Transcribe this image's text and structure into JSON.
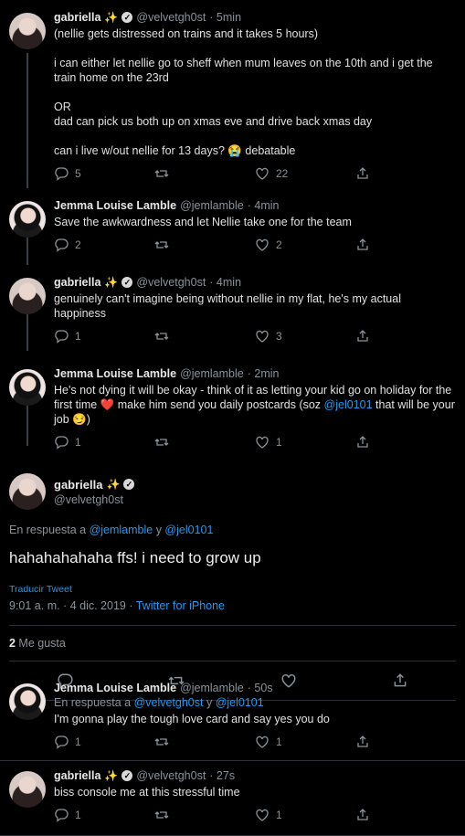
{
  "tweets": [
    {
      "name": "gabriella",
      "emoji": "✨",
      "handle": "@velvetgh0st",
      "time": "· 5min",
      "text": "(nellie gets distressed on trains and it takes 5 hours)\n\ni can either let nellie go to sheff when mum leaves on the 10th and i get the train home on the 23rd\n\nOR\ndad can pick us both up on xmas eve and drive back xmas day\n\ncan i live w/out nellie for 13 days? 😭 debatable",
      "replies": "5",
      "likes": "22"
    },
    {
      "name": "Jemma Louise Lamble",
      "handle": "@jemlamble",
      "time": "· 4min",
      "text": "Save the awkwardness and let Nellie take one for the team",
      "replies": "2",
      "likes": "2"
    },
    {
      "name": "gabriella",
      "emoji": "✨",
      "handle": "@velvetgh0st",
      "time": "· 4min",
      "text": "genuinely can't imagine being without nellie in my flat, he's my actual happiness",
      "replies": "1",
      "likes": "3"
    },
    {
      "name": "Jemma Louise Lamble",
      "handle": "@jemlamble",
      "time": "· 2min",
      "text_a": "He's not dying it will be okay - think of it as letting your kid go on holiday for the first time ❤️ make him send you daily postcards (soz ",
      "mention": "@jel0101",
      "text_b": " that will be your job 😏)",
      "replies": "1",
      "likes": "1"
    }
  ],
  "main": {
    "name": "gabriella",
    "emoji": "✨",
    "handle": "@velvetgh0st",
    "reply_prefix": "En respuesta a ",
    "reply_user1": "@jemlamble",
    "reply_and": " y ",
    "reply_user2": "@jel0101",
    "text": "hahahahahaha ffs! i need to grow up",
    "translate": "Traducir Tweet",
    "datetime": "9:01 a. m. · 4 dic. 2019 · ",
    "source": "Twitter for iPhone",
    "likes_count": "2",
    "likes_label": " Me gusta"
  },
  "replies": [
    {
      "name": "Jemma Louise Lamble",
      "handle": "@jemlamble",
      "time": "· 50s",
      "reply_prefix": "En respuesta a ",
      "reply_user1": "@velvetgh0st",
      "reply_and": " y ",
      "reply_user2": "@jel0101",
      "text": "I'm gonna play the tough love card and say yes you do",
      "replies": "1",
      "likes": "1"
    },
    {
      "name": "gabriella",
      "emoji": "✨",
      "handle": "@velvetgh0st",
      "time": "· 27s",
      "text": "biss console me at this stressful time",
      "replies": "1",
      "likes": "1"
    }
  ]
}
